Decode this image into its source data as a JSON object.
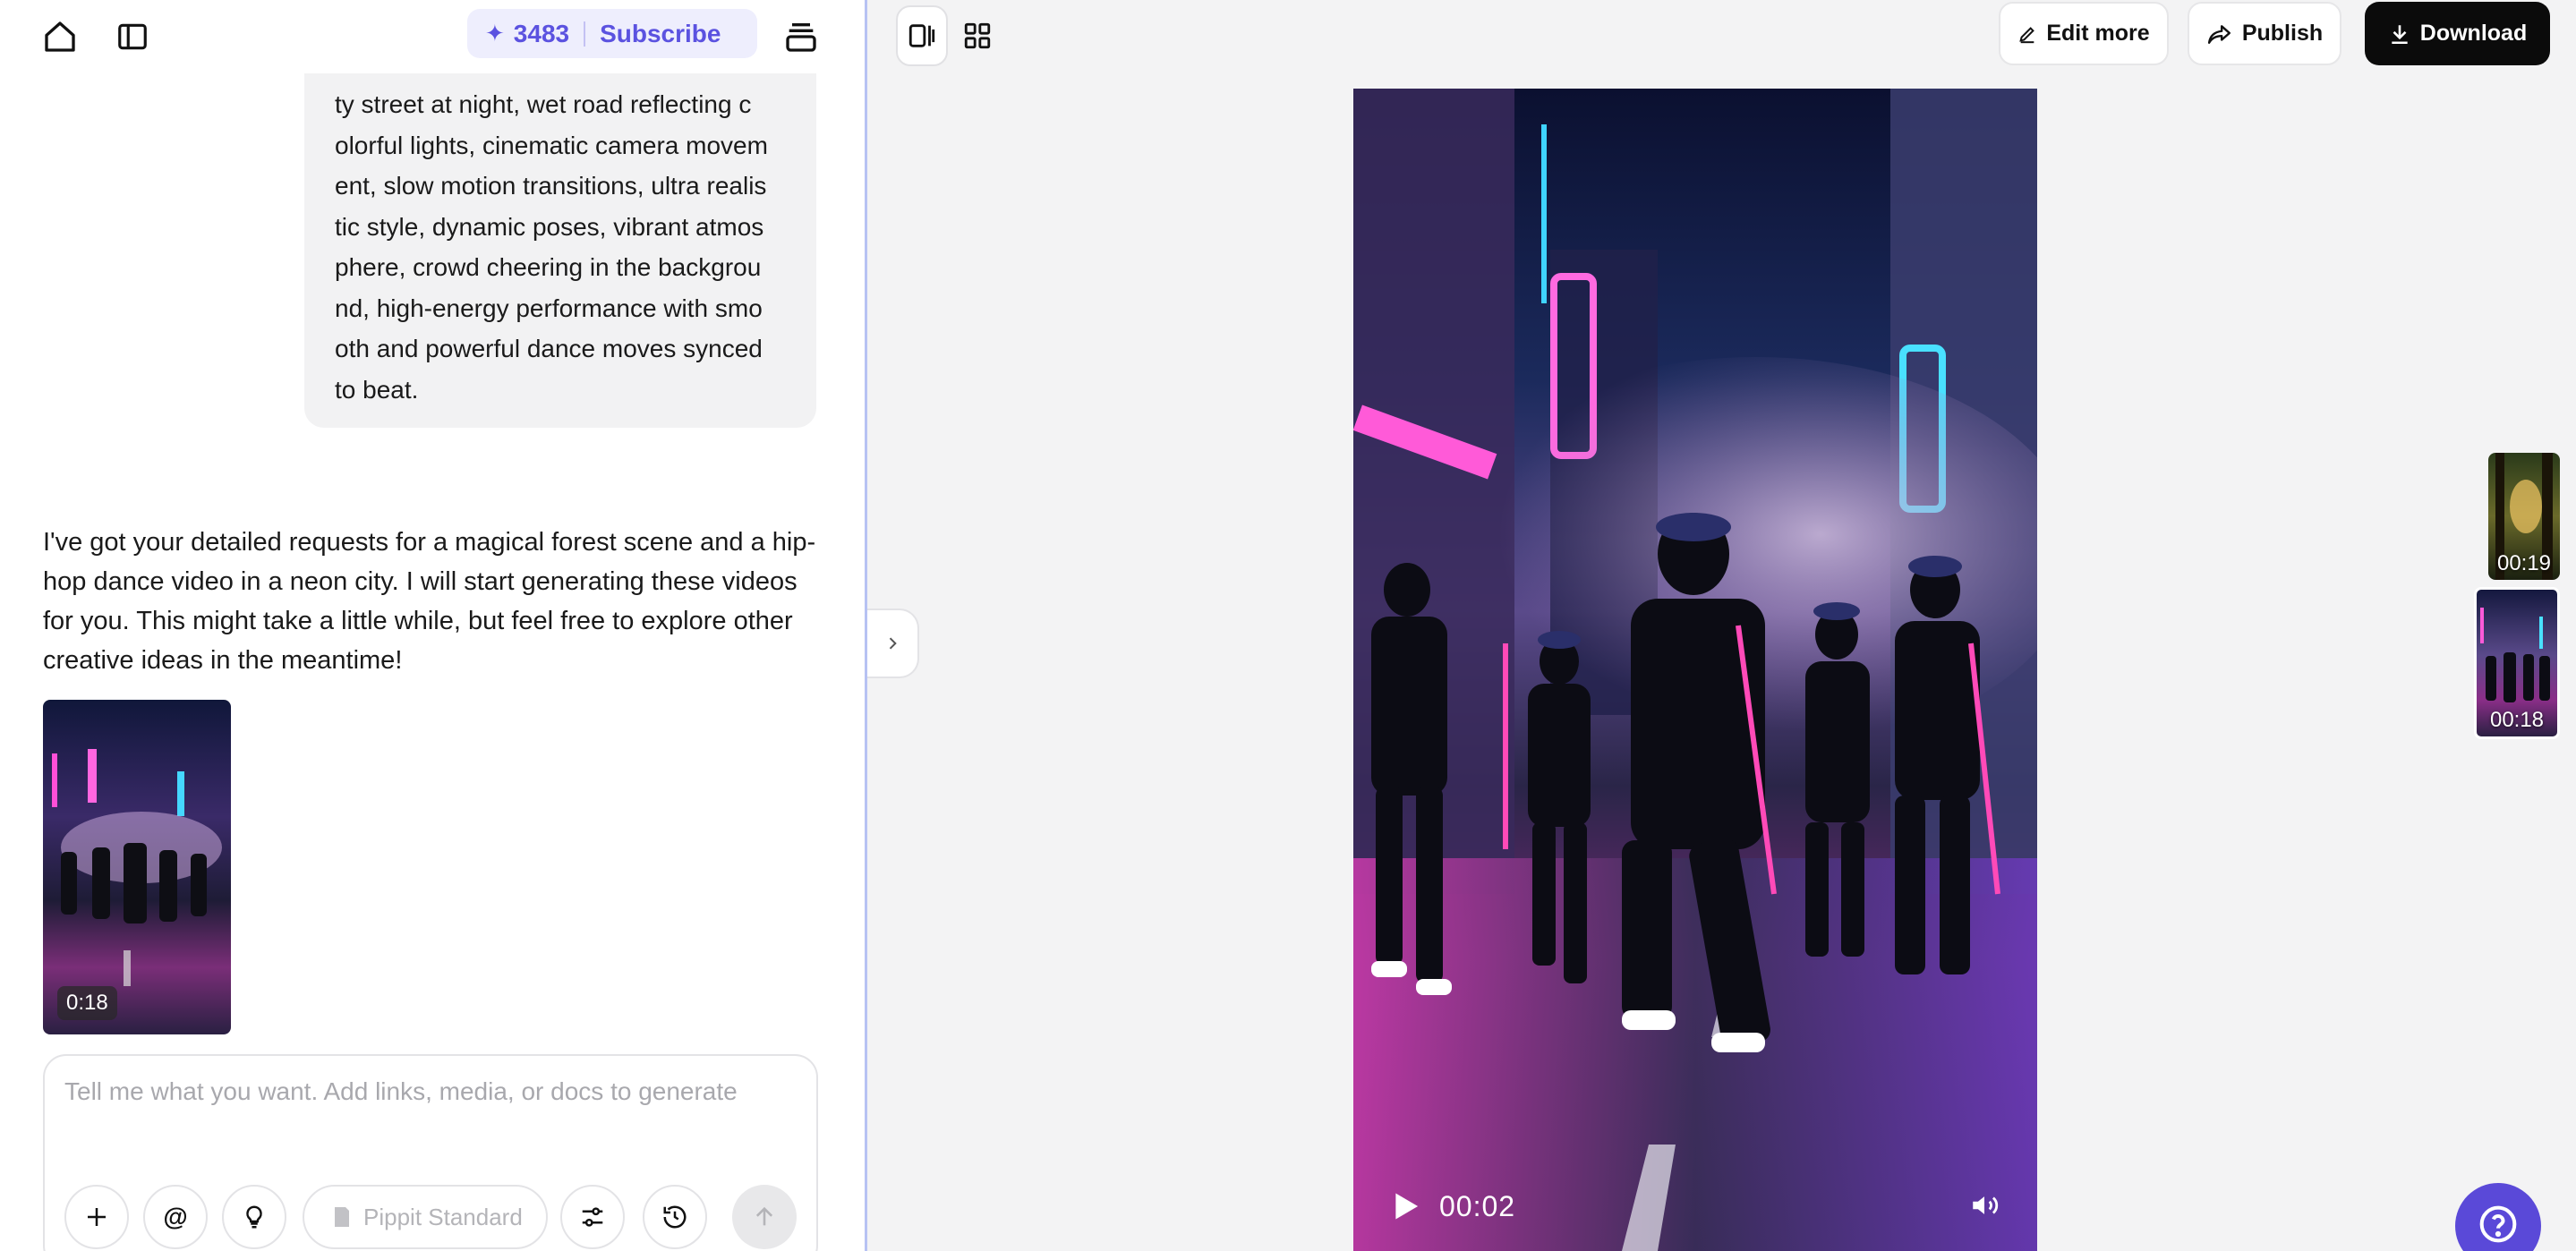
{
  "header": {
    "credits": "3483",
    "subscribe_label": "Subscribe"
  },
  "chat": {
    "user_message": "ty street at night, wet road reflecting c\nolorful lights, cinematic camera movem\nent, slow motion transitions, ultra realis\ntic style, dynamic poses, vibrant atmos\nphere, crowd cheering in the backgrou\nnd, high-energy performance with smo\noth and powerful dance moves synced\nto beat.",
    "assistant_message": "I've got your detailed requests for a magical forest scene and a hip-hop dance video in a neon city. I will start generating these videos for you. This might take a little while, but feel free to explore other creative ideas in the meantime!",
    "video_duration": "0:18"
  },
  "composer": {
    "placeholder": "Tell me what you want. Add links, media, or docs to generate",
    "model_label": "Pippit Standard"
  },
  "toolbar": {
    "edit_more_label": "Edit more",
    "publish_label": "Publish",
    "download_label": "Download"
  },
  "player": {
    "current_time": "00:02"
  },
  "video_list": [
    {
      "duration": "00:19"
    },
    {
      "duration": "00:18"
    }
  ],
  "colors": {
    "accent": "#5b52e0",
    "help_button": "#5a49d8",
    "download_button": "#0b0b0b",
    "divider": "#b7c2f3"
  }
}
